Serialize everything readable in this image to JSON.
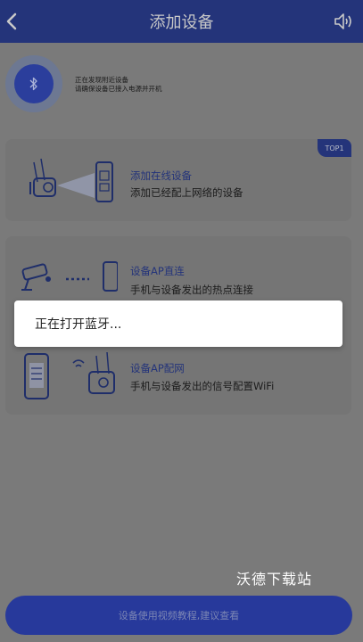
{
  "header": {
    "title": "添加设备"
  },
  "bluetooth": {
    "line1": "正在发现附近设备",
    "line2": "请确保设备已接入电源并开机"
  },
  "options": [
    {
      "title": "添加在线设备",
      "desc": "添加已经配上网络的设备",
      "badge": "TOP1"
    },
    {
      "title": "设备AP直连",
      "desc": "手机与设备发出的热点连接"
    },
    {
      "title": "设备AP配网",
      "desc": "手机与设备发出的信号配置WiFi"
    }
  ],
  "toast": {
    "text": "正在打开蓝牙..."
  },
  "watermark": "沃德下载站",
  "bottom_button": {
    "label": "设备使用视频教程,建议查看"
  },
  "colors": {
    "header_bg": "#24347a",
    "accent": "#27399b",
    "overlay": "#7a7a7a"
  }
}
